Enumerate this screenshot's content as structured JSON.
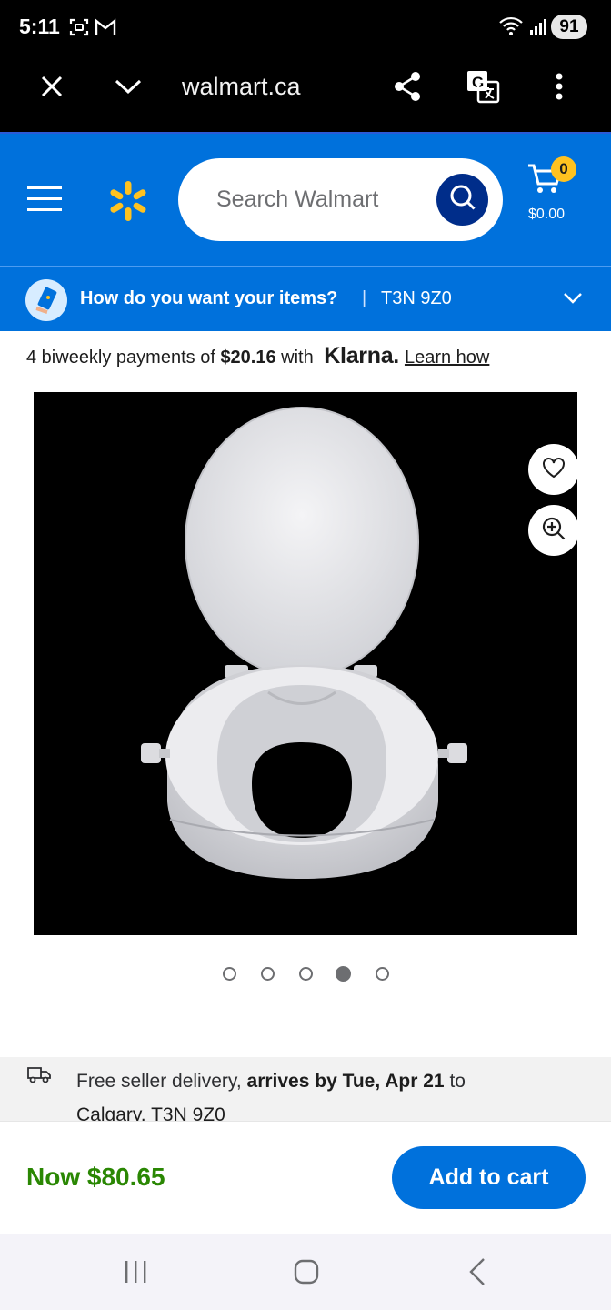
{
  "status_bar": {
    "time": "5:11",
    "battery": "91",
    "icons": [
      "screenshot-icon",
      "gmail-icon",
      "wifi-icon",
      "signal-icon",
      "battery-icon"
    ]
  },
  "browser": {
    "url": "walmart.ca",
    "icons": [
      "close-icon",
      "chevron-down-icon",
      "share-icon",
      "translate-icon",
      "more-vert-icon"
    ]
  },
  "header": {
    "search_placeholder": "Search Walmart",
    "cart_count": "0",
    "cart_total": "$0.00",
    "brand_color": "#0071dc",
    "spark_color": "#ffc220"
  },
  "delivery_band": {
    "question": "How do you want your items?",
    "separator": "|",
    "postal_code": "T3N 9Z0"
  },
  "klarna": {
    "prefix": "4 biweekly payments of ",
    "amount": "$20.16",
    "middle": " with ",
    "brand": "Klarna.",
    "link": "Learn how"
  },
  "product": {
    "carousel_count": 5,
    "carousel_active": 4
  },
  "fulfillment": {
    "text_prefix": "Free seller delivery, ",
    "arrival": "arrives by Tue, Apr 21",
    "text_suffix": " to",
    "location": "Calgary, T3N 9Z0"
  },
  "price_bar": {
    "price": "Now $80.65",
    "add_to_cart": "Add to cart",
    "price_color": "#2a8703"
  },
  "nav": {
    "icons": [
      "recent-apps-icon",
      "home-icon",
      "back-icon"
    ]
  }
}
